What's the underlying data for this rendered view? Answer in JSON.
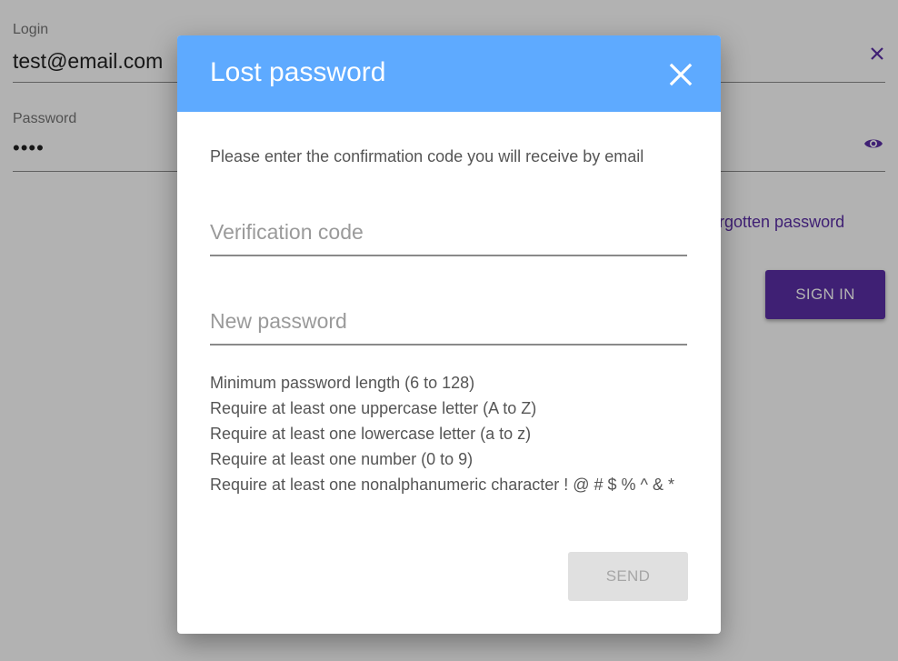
{
  "login_form": {
    "login_label": "Login",
    "login_value": "test@email.com",
    "password_label": "Password",
    "password_value": "••••",
    "forgot_link": "Forgotten password",
    "signin_label": "SIGN IN",
    "accent_color": "#5b2ea6",
    "clear_icon": "close-icon",
    "visibility_icon": "eye-icon"
  },
  "dialog": {
    "title": "Lost password",
    "header_color": "#5eaaff",
    "close_icon": "close-icon",
    "description": "Please enter the confirmation code you will receive by email",
    "verification_placeholder": "Verification code",
    "verification_value": "",
    "new_password_placeholder": "New password",
    "new_password_value": "",
    "rules": [
      "Minimum password length (6 to 128)",
      "Require at least one uppercase letter (A to Z)",
      "Require at least one lowercase letter (a to z)",
      "Require at least one number (0 to 9)",
      "Require at least one nonalphanumeric character ! @ # $ % ^ & *"
    ],
    "send_label": "SEND",
    "send_disabled": true
  }
}
